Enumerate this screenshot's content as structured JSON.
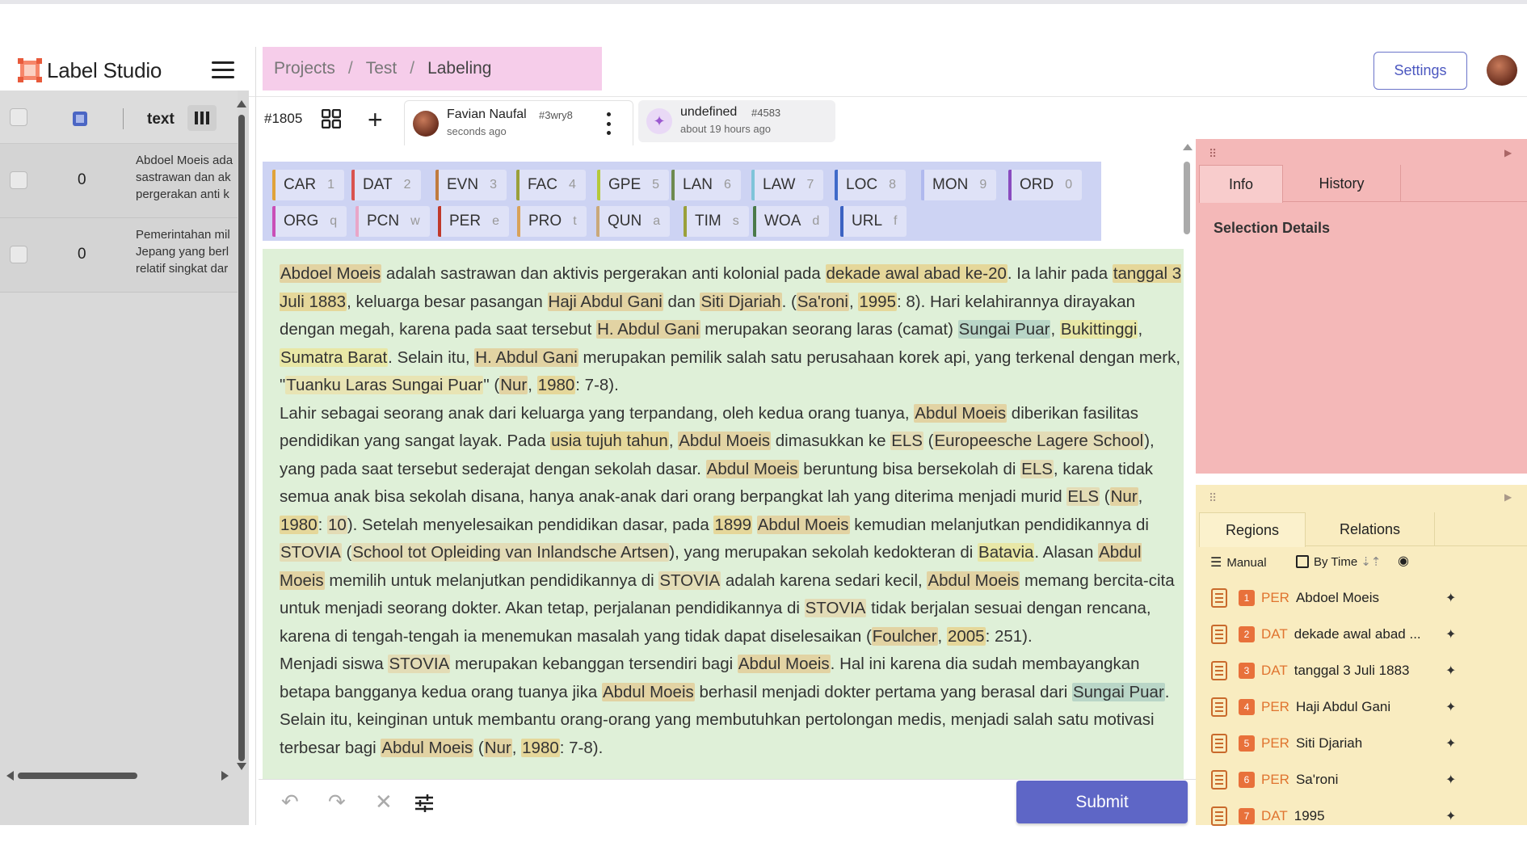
{
  "app": {
    "name": "Label Studio"
  },
  "breadcrumb": {
    "items": [
      "Projects",
      "Test",
      "Labeling"
    ]
  },
  "header": {
    "settings_label": "Settings"
  },
  "left_panel": {
    "column_label": "text",
    "rows": [
      {
        "value": "0",
        "text_lines": [
          "Abdoel Moeis ada",
          "sastrawan dan ak",
          "pergerakan anti k"
        ]
      },
      {
        "value": "0",
        "text_lines": [
          "Pemerintahan mil",
          "Jepang yang berl",
          "relatif singkat dar"
        ]
      }
    ]
  },
  "toolbar": {
    "task_id": "#1805",
    "annotations": [
      {
        "name": "Favian Naufal",
        "id": "#3wry8",
        "time": "seconds ago"
      },
      {
        "name": "undefined",
        "id": "#4583",
        "time": "about 19 hours ago"
      }
    ]
  },
  "labels": [
    {
      "name": "CAR",
      "key": "1",
      "color": "#e0a33a"
    },
    {
      "name": "DAT",
      "key": "2",
      "color": "#d9534f"
    },
    {
      "name": "EVN",
      "key": "3",
      "color": "#c07b3e"
    },
    {
      "name": "FAC",
      "key": "4",
      "color": "#9aa03a"
    },
    {
      "name": "GPE",
      "key": "5",
      "color": "#b5c93a"
    },
    {
      "name": "LAN",
      "key": "6",
      "color": "#6e8a4f"
    },
    {
      "name": "LAW",
      "key": "7",
      "color": "#7fc4d9"
    },
    {
      "name": "LOC",
      "key": "8",
      "color": "#3f6ac9"
    },
    {
      "name": "MON",
      "key": "9",
      "color": "#b0b9ee"
    },
    {
      "name": "ORD",
      "key": "0",
      "color": "#8a4bbf"
    },
    {
      "name": "ORG",
      "key": "q",
      "color": "#c94fb7"
    },
    {
      "name": "PCN",
      "key": "w",
      "color": "#e8a6c8"
    },
    {
      "name": "PER",
      "key": "e",
      "color": "#c0392b"
    },
    {
      "name": "PRO",
      "key": "t",
      "color": "#d8a25a"
    },
    {
      "name": "QUN",
      "key": "a",
      "color": "#c9a87a"
    },
    {
      "name": "TIM",
      "key": "s",
      "color": "#9aa03a"
    },
    {
      "name": "WOA",
      "key": "d",
      "color": "#4a7a4a"
    },
    {
      "name": "URL",
      "key": "f",
      "color": "#3b62c2"
    }
  ],
  "document": {
    "paragraphs": [
      [
        {
          "t": "Abdoel Moeis",
          "l": "PER"
        },
        {
          "t": " adalah sastrawan dan aktivis pergerakan anti kolonial pada "
        },
        {
          "t": "dekade awal abad ke-20",
          "l": "DAT"
        },
        {
          "t": ". Ia lahir pada "
        },
        {
          "t": "tanggal 3 Juli 1883",
          "l": "DAT"
        },
        {
          "t": ", keluarga besar pasangan "
        },
        {
          "t": "Haji Abdul Gani",
          "l": "PER"
        },
        {
          "t": " dan "
        },
        {
          "t": "Siti Djariah",
          "l": "PER"
        },
        {
          "t": ". ("
        },
        {
          "t": "Sa'roni",
          "l": "PER"
        },
        {
          "t": ", "
        },
        {
          "t": "1995",
          "l": "DAT"
        },
        {
          "t": ": 8). Hari kelahirannya dirayakan dengan megah, karena pada saat tersebut "
        },
        {
          "t": "H. Abdul Gani",
          "l": "PER"
        },
        {
          "t": " merupakan seorang laras (camat) "
        },
        {
          "t": "Sungai Puar",
          "l": "LOC"
        },
        {
          "t": ", "
        },
        {
          "t": "Bukittinggi",
          "l": "GPE"
        },
        {
          "t": ", "
        },
        {
          "t": "Sumatra Barat",
          "l": "GPE"
        },
        {
          "t": ". Selain itu, "
        },
        {
          "t": "H. Abdul Gani",
          "l": "PER"
        },
        {
          "t": " merupakan pemilik salah satu perusahaan korek api, yang terkenal dengan merk, \""
        },
        {
          "t": "Tuanku Laras Sungai Puar",
          "l": "PRO"
        },
        {
          "t": "\" ("
        },
        {
          "t": "Nur",
          "l": "PER"
        },
        {
          "t": ", "
        },
        {
          "t": "1980",
          "l": "DAT"
        },
        {
          "t": ": 7-8)."
        }
      ],
      [
        {
          "t": "Lahir sebagai seorang anak dari keluarga yang terpandang, oleh kedua orang tuanya, "
        },
        {
          "t": "Abdul Moeis",
          "l": "PER"
        },
        {
          "t": " diberikan fasilitas pendidikan yang sangat layak. Pada "
        },
        {
          "t": "usia tujuh tahun",
          "l": "DAT"
        },
        {
          "t": ", "
        },
        {
          "t": "Abdul Moeis",
          "l": "PER"
        },
        {
          "t": " dimasukkan ke "
        },
        {
          "t": "ELS",
          "l": "ORG"
        },
        {
          "t": " ("
        },
        {
          "t": "Europeesche Lagere School",
          "l": "ORG"
        },
        {
          "t": "), yang pada saat tersebut sederajat dengan sekolah dasar. "
        },
        {
          "t": "Abdul Moeis",
          "l": "PER"
        },
        {
          "t": " beruntung bisa bersekolah di "
        },
        {
          "t": "ELS",
          "l": "ORG"
        },
        {
          "t": ", karena tidak semua anak bisa sekolah disana, hanya anak-anak dari orang berpangkat lah yang diterima menjadi murid "
        },
        {
          "t": "ELS",
          "l": "ORG"
        },
        {
          "t": " ("
        },
        {
          "t": "Nur",
          "l": "PER"
        },
        {
          "t": ", "
        },
        {
          "t": "1980",
          "l": "DAT"
        },
        {
          "t": ": "
        },
        {
          "t": "10",
          "l": "ORG"
        },
        {
          "t": "). Setelah menyelesaikan pendidikan dasar, pada "
        },
        {
          "t": "1899",
          "l": "DAT"
        },
        {
          "t": " "
        },
        {
          "t": "Abdul Moeis",
          "l": "PER"
        },
        {
          "t": " kemudian melanjutkan pendidikannya di "
        },
        {
          "t": "STOVIA",
          "l": "ORG"
        },
        {
          "t": " ("
        },
        {
          "t": "School tot Opleiding van Inlandsche Artsen",
          "l": "ORG"
        },
        {
          "t": "), yang merupakan sekolah kedokteran di "
        },
        {
          "t": "Batavia",
          "l": "GPE"
        },
        {
          "t": ". Alasan "
        },
        {
          "t": "Abdul Moeis",
          "l": "PER"
        },
        {
          "t": " memilih untuk melanjutkan pendidikannya di "
        },
        {
          "t": "STOVIA",
          "l": "ORG"
        },
        {
          "t": " adalah karena sedari kecil, "
        },
        {
          "t": "Abdul Moeis",
          "l": "PER"
        },
        {
          "t": " memang bercita-cita untuk menjadi seorang dokter. Akan tetap, perjalanan pendidikannya di "
        },
        {
          "t": "STOVIA",
          "l": "ORG"
        },
        {
          "t": " tidak berjalan sesuai dengan rencana, karena di tengah-tengah ia menemukan masalah yang tidak dapat diselesaikan ("
        },
        {
          "t": "Foulcher",
          "l": "PER"
        },
        {
          "t": ", "
        },
        {
          "t": "2005",
          "l": "DAT"
        },
        {
          "t": ": 251)."
        }
      ],
      [
        {
          "t": "Menjadi siswa "
        },
        {
          "t": "STOVIA",
          "l": "ORG"
        },
        {
          "t": " merupakan kebanggan tersendiri bagi "
        },
        {
          "t": "Abdul Moeis",
          "l": "PER"
        },
        {
          "t": ". Hal ini karena dia sudah membayangkan betapa bangganya kedua orang tuanya jika "
        },
        {
          "t": "Abdul Moeis",
          "l": "PER"
        },
        {
          "t": " berhasil menjadi dokter pertama yang berasal dari "
        },
        {
          "t": "Sungai Puar",
          "l": "LOC"
        },
        {
          "t": ". Selain itu, keinginan untuk membantu orang-orang yang membutuhkan pertolongan medis, menjadi salah satu motivasi terbesar bagi "
        },
        {
          "t": "Abdul Moeis",
          "l": "PER"
        },
        {
          "t": " ("
        },
        {
          "t": "Nur",
          "l": "PER"
        },
        {
          "t": ", "
        },
        {
          "t": "1980",
          "l": "DAT"
        },
        {
          "t": ": 7-8)."
        }
      ]
    ]
  },
  "bottom": {
    "submit_label": "Submit"
  },
  "info_panel": {
    "tabs": [
      "Info",
      "History"
    ],
    "section_title": "Selection Details"
  },
  "regions_panel": {
    "tabs": [
      "Regions",
      "Relations"
    ],
    "sort_manual": "Manual",
    "sort_time": "By Time",
    "items": [
      {
        "index": "1",
        "label": "PER",
        "text": "Abdoel Moeis"
      },
      {
        "index": "2",
        "label": "DAT",
        "text": "dekade awal abad ..."
      },
      {
        "index": "3",
        "label": "DAT",
        "text": "tanggal 3 Juli 1883"
      },
      {
        "index": "4",
        "label": "PER",
        "text": "Haji Abdul Gani"
      },
      {
        "index": "5",
        "label": "PER",
        "text": "Siti Djariah"
      },
      {
        "index": "6",
        "label": "PER",
        "text": "Sa'roni"
      },
      {
        "index": "7",
        "label": "DAT",
        "text": "1995"
      }
    ]
  }
}
